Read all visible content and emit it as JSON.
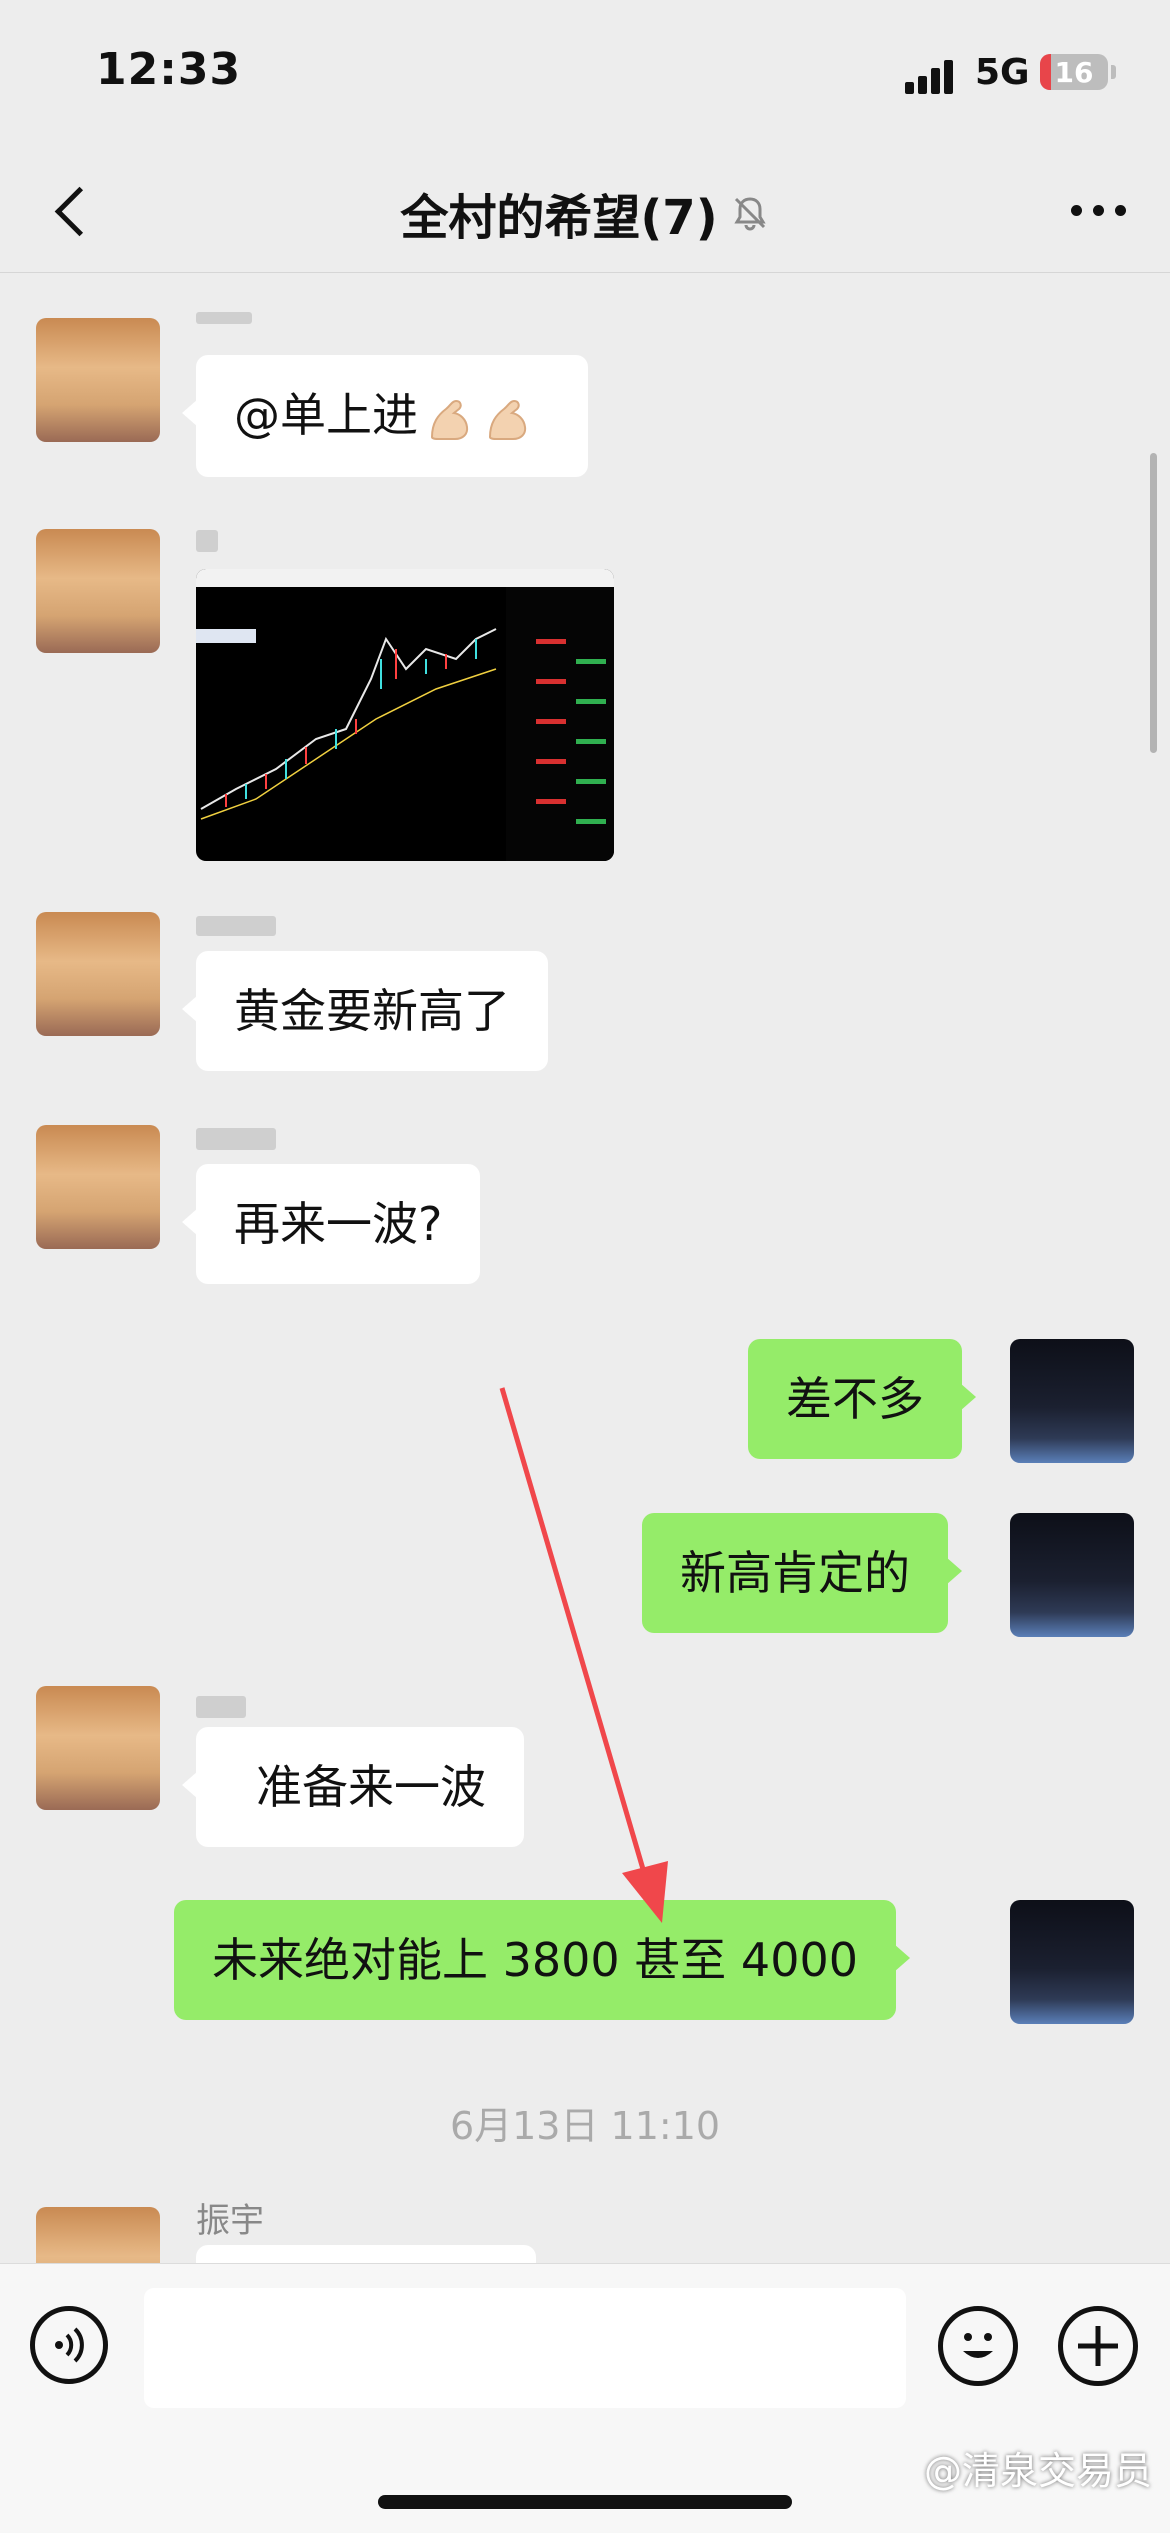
{
  "status_bar": {
    "time": "12:33",
    "network": "5G",
    "battery": "16"
  },
  "nav": {
    "title": "全村的希望(7)",
    "icons": [
      "back-arrow-icon",
      "mute-bell-icon",
      "more-icon"
    ]
  },
  "messages": [
    {
      "side": "left",
      "type": "text",
      "text": "@单上进",
      "emoji": "flexed-biceps-icon"
    },
    {
      "side": "left",
      "type": "image",
      "icon": "stock-chart-screenshot"
    },
    {
      "side": "left",
      "type": "text",
      "text": "黄金要新高了"
    },
    {
      "side": "left",
      "type": "text",
      "text": "再来一波?"
    },
    {
      "side": "right",
      "type": "text",
      "text": "差不多"
    },
    {
      "side": "right",
      "type": "text",
      "text": "新高肯定的"
    },
    {
      "side": "left",
      "type": "text",
      "text": "准备来一波"
    },
    {
      "side": "right",
      "type": "text",
      "text": "未来绝对能上 3800  甚至 4000"
    },
    {
      "side": "left",
      "type": "text",
      "sender": "振宇",
      "text": ""
    }
  ],
  "timestamp": "6月13日 11:10",
  "input": {
    "placeholder": ""
  },
  "watermark": "@清泉交易员",
  "colors": {
    "outgoing_bubble": "#95ec69",
    "incoming_bubble": "#ffffff",
    "background": "#ededed",
    "annotation_arrow": "#f0474b"
  }
}
